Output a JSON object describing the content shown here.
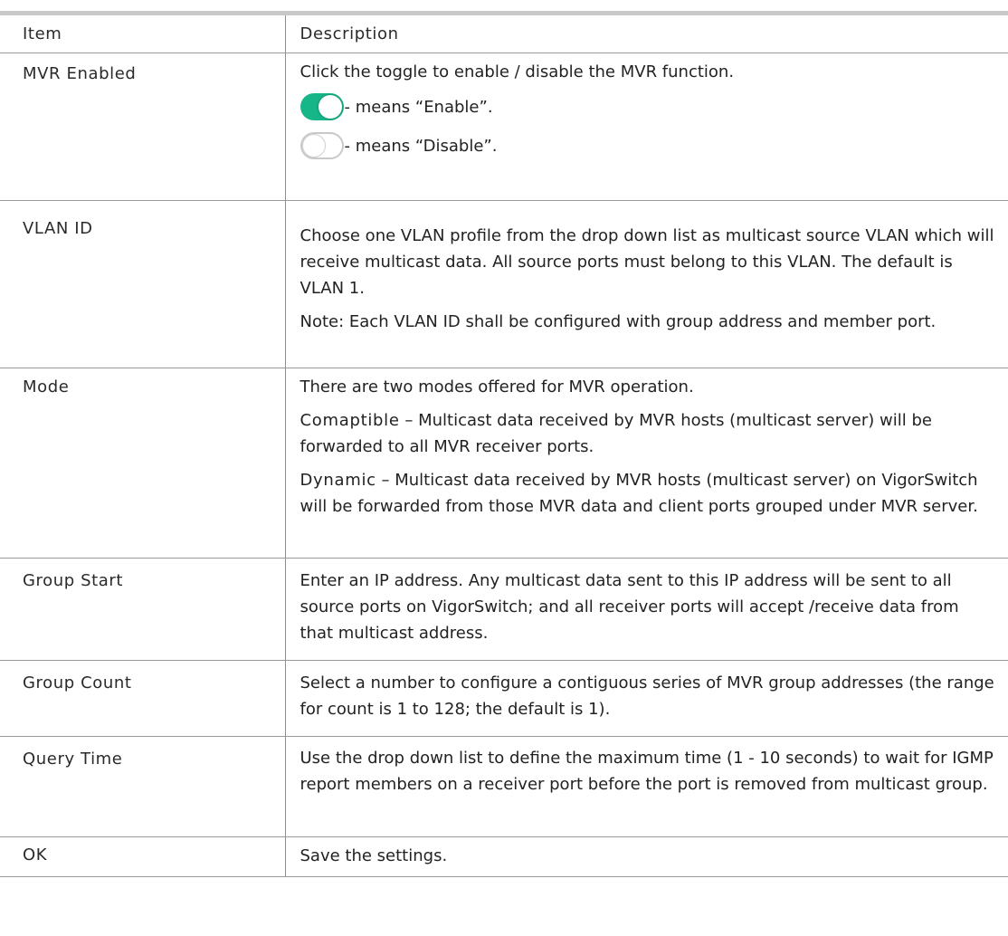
{
  "header": {
    "item": "Item",
    "description": "Description"
  },
  "rows": [
    {
      "item": "MVR Enabled",
      "desc": "Click the toggle to enable / disable the MVR function.",
      "toggle_on_text": "- means “Enable”.",
      "toggle_off_text": "- means “Disable”."
    },
    {
      "item": "VLAN ID",
      "desc": "Choose one VLAN profile from the drop down list as multicast source VLAN which will receive multicast data. All source ports must belong to this VLAN. The default is VLAN 1.",
      "note": "Note: Each VLAN ID shall be configured with group address and member port."
    },
    {
      "item": "Mode",
      "desc": "There are two modes offered for MVR operation.",
      "compat_term": "Comaptible",
      "compat_text": " – Multicast data received by MVR hosts (multicast server) will be forwarded to all MVR receiver ports.",
      "dynamic_term": "Dynamic",
      "dynamic_text": " – Multicast data received by MVR hosts (multicast server) on VigorSwitch will be forwarded from those MVR data and client ports grouped under MVR server."
    },
    {
      "item": "Group Start",
      "desc": "Enter an IP address. Any multicast data sent to this IP address will be sent to all source ports on VigorSwitch; and all receiver ports will accept /receive data from that multicast address."
    },
    {
      "item": "Group Count",
      "desc": "Select a number to configure a contiguous series of MVR group addresses (the range for count is 1 to 128; the default is 1)."
    },
    {
      "item": "Query Time",
      "desc": "Use the drop down list to define the maximum time (1 - 10 seconds) to wait for IGMP report members on a receiver port before the port is removed from multicast group."
    },
    {
      "item": "OK",
      "desc": "Save the settings."
    }
  ],
  "colors": {
    "toggle_on": "#17b689",
    "rule": "#c8c8c8"
  },
  "icons": {
    "toggle_on": "toggle-on-icon",
    "toggle_off": "toggle-off-icon"
  }
}
